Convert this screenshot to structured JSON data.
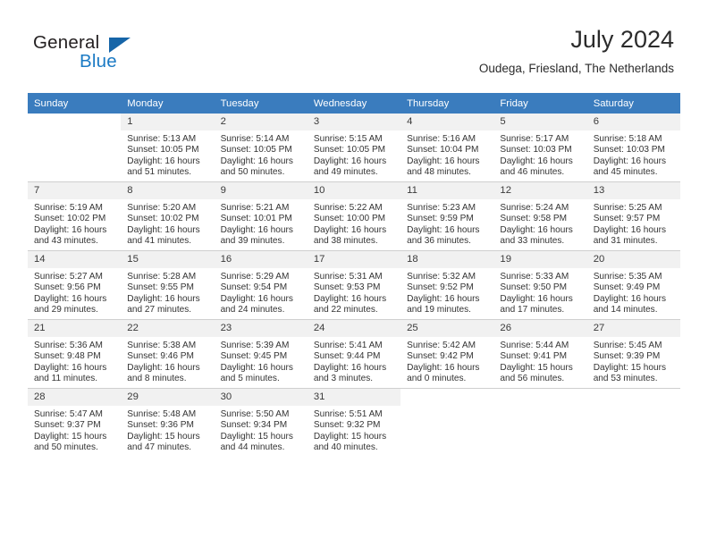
{
  "brand": {
    "word_one": "General",
    "word_two": "Blue",
    "mark": "triangle-logo-mark",
    "accent_dark": "#1665a8",
    "accent_blue": "#1b7ac4"
  },
  "header": {
    "title": "July 2024",
    "subtitle": "Oudega, Friesland, The Netherlands"
  },
  "theme": {
    "header_row_bg": "#3a7cbe",
    "header_row_text": "#ffffff",
    "daynum_bg": "#f1f1f1",
    "grid_line": "#cfcfcf"
  },
  "calendar": {
    "weekday_headers": [
      "Sunday",
      "Monday",
      "Tuesday",
      "Wednesday",
      "Thursday",
      "Friday",
      "Saturday"
    ],
    "weeks": [
      [
        {
          "day": "",
          "blank": true,
          "sunrise": "",
          "sunset": "",
          "daylight_1": "",
          "daylight_2": ""
        },
        {
          "day": "1",
          "sunrise": "Sunrise: 5:13 AM",
          "sunset": "Sunset: 10:05 PM",
          "daylight_1": "Daylight: 16 hours",
          "daylight_2": "and 51 minutes."
        },
        {
          "day": "2",
          "sunrise": "Sunrise: 5:14 AM",
          "sunset": "Sunset: 10:05 PM",
          "daylight_1": "Daylight: 16 hours",
          "daylight_2": "and 50 minutes."
        },
        {
          "day": "3",
          "sunrise": "Sunrise: 5:15 AM",
          "sunset": "Sunset: 10:05 PM",
          "daylight_1": "Daylight: 16 hours",
          "daylight_2": "and 49 minutes."
        },
        {
          "day": "4",
          "sunrise": "Sunrise: 5:16 AM",
          "sunset": "Sunset: 10:04 PM",
          "daylight_1": "Daylight: 16 hours",
          "daylight_2": "and 48 minutes."
        },
        {
          "day": "5",
          "sunrise": "Sunrise: 5:17 AM",
          "sunset": "Sunset: 10:03 PM",
          "daylight_1": "Daylight: 16 hours",
          "daylight_2": "and 46 minutes."
        },
        {
          "day": "6",
          "sunrise": "Sunrise: 5:18 AM",
          "sunset": "Sunset: 10:03 PM",
          "daylight_1": "Daylight: 16 hours",
          "daylight_2": "and 45 minutes."
        }
      ],
      [
        {
          "day": "7",
          "sunrise": "Sunrise: 5:19 AM",
          "sunset": "Sunset: 10:02 PM",
          "daylight_1": "Daylight: 16 hours",
          "daylight_2": "and 43 minutes."
        },
        {
          "day": "8",
          "sunrise": "Sunrise: 5:20 AM",
          "sunset": "Sunset: 10:02 PM",
          "daylight_1": "Daylight: 16 hours",
          "daylight_2": "and 41 minutes."
        },
        {
          "day": "9",
          "sunrise": "Sunrise: 5:21 AM",
          "sunset": "Sunset: 10:01 PM",
          "daylight_1": "Daylight: 16 hours",
          "daylight_2": "and 39 minutes."
        },
        {
          "day": "10",
          "sunrise": "Sunrise: 5:22 AM",
          "sunset": "Sunset: 10:00 PM",
          "daylight_1": "Daylight: 16 hours",
          "daylight_2": "and 38 minutes."
        },
        {
          "day": "11",
          "sunrise": "Sunrise: 5:23 AM",
          "sunset": "Sunset: 9:59 PM",
          "daylight_1": "Daylight: 16 hours",
          "daylight_2": "and 36 minutes."
        },
        {
          "day": "12",
          "sunrise": "Sunrise: 5:24 AM",
          "sunset": "Sunset: 9:58 PM",
          "daylight_1": "Daylight: 16 hours",
          "daylight_2": "and 33 minutes."
        },
        {
          "day": "13",
          "sunrise": "Sunrise: 5:25 AM",
          "sunset": "Sunset: 9:57 PM",
          "daylight_1": "Daylight: 16 hours",
          "daylight_2": "and 31 minutes."
        }
      ],
      [
        {
          "day": "14",
          "sunrise": "Sunrise: 5:27 AM",
          "sunset": "Sunset: 9:56 PM",
          "daylight_1": "Daylight: 16 hours",
          "daylight_2": "and 29 minutes."
        },
        {
          "day": "15",
          "sunrise": "Sunrise: 5:28 AM",
          "sunset": "Sunset: 9:55 PM",
          "daylight_1": "Daylight: 16 hours",
          "daylight_2": "and 27 minutes."
        },
        {
          "day": "16",
          "sunrise": "Sunrise: 5:29 AM",
          "sunset": "Sunset: 9:54 PM",
          "daylight_1": "Daylight: 16 hours",
          "daylight_2": "and 24 minutes."
        },
        {
          "day": "17",
          "sunrise": "Sunrise: 5:31 AM",
          "sunset": "Sunset: 9:53 PM",
          "daylight_1": "Daylight: 16 hours",
          "daylight_2": "and 22 minutes."
        },
        {
          "day": "18",
          "sunrise": "Sunrise: 5:32 AM",
          "sunset": "Sunset: 9:52 PM",
          "daylight_1": "Daylight: 16 hours",
          "daylight_2": "and 19 minutes."
        },
        {
          "day": "19",
          "sunrise": "Sunrise: 5:33 AM",
          "sunset": "Sunset: 9:50 PM",
          "daylight_1": "Daylight: 16 hours",
          "daylight_2": "and 17 minutes."
        },
        {
          "day": "20",
          "sunrise": "Sunrise: 5:35 AM",
          "sunset": "Sunset: 9:49 PM",
          "daylight_1": "Daylight: 16 hours",
          "daylight_2": "and 14 minutes."
        }
      ],
      [
        {
          "day": "21",
          "sunrise": "Sunrise: 5:36 AM",
          "sunset": "Sunset: 9:48 PM",
          "daylight_1": "Daylight: 16 hours",
          "daylight_2": "and 11 minutes."
        },
        {
          "day": "22",
          "sunrise": "Sunrise: 5:38 AM",
          "sunset": "Sunset: 9:46 PM",
          "daylight_1": "Daylight: 16 hours",
          "daylight_2": "and 8 minutes."
        },
        {
          "day": "23",
          "sunrise": "Sunrise: 5:39 AM",
          "sunset": "Sunset: 9:45 PM",
          "daylight_1": "Daylight: 16 hours",
          "daylight_2": "and 5 minutes."
        },
        {
          "day": "24",
          "sunrise": "Sunrise: 5:41 AM",
          "sunset": "Sunset: 9:44 PM",
          "daylight_1": "Daylight: 16 hours",
          "daylight_2": "and 3 minutes."
        },
        {
          "day": "25",
          "sunrise": "Sunrise: 5:42 AM",
          "sunset": "Sunset: 9:42 PM",
          "daylight_1": "Daylight: 16 hours",
          "daylight_2": "and 0 minutes."
        },
        {
          "day": "26",
          "sunrise": "Sunrise: 5:44 AM",
          "sunset": "Sunset: 9:41 PM",
          "daylight_1": "Daylight: 15 hours",
          "daylight_2": "and 56 minutes."
        },
        {
          "day": "27",
          "sunrise": "Sunrise: 5:45 AM",
          "sunset": "Sunset: 9:39 PM",
          "daylight_1": "Daylight: 15 hours",
          "daylight_2": "and 53 minutes."
        }
      ],
      [
        {
          "day": "28",
          "sunrise": "Sunrise: 5:47 AM",
          "sunset": "Sunset: 9:37 PM",
          "daylight_1": "Daylight: 15 hours",
          "daylight_2": "and 50 minutes."
        },
        {
          "day": "29",
          "sunrise": "Sunrise: 5:48 AM",
          "sunset": "Sunset: 9:36 PM",
          "daylight_1": "Daylight: 15 hours",
          "daylight_2": "and 47 minutes."
        },
        {
          "day": "30",
          "sunrise": "Sunrise: 5:50 AM",
          "sunset": "Sunset: 9:34 PM",
          "daylight_1": "Daylight: 15 hours",
          "daylight_2": "and 44 minutes."
        },
        {
          "day": "31",
          "sunrise": "Sunrise: 5:51 AM",
          "sunset": "Sunset: 9:32 PM",
          "daylight_1": "Daylight: 15 hours",
          "daylight_2": "and 40 minutes."
        },
        {
          "day": "",
          "blank": true,
          "sunrise": "",
          "sunset": "",
          "daylight_1": "",
          "daylight_2": ""
        },
        {
          "day": "",
          "blank": true,
          "sunrise": "",
          "sunset": "",
          "daylight_1": "",
          "daylight_2": ""
        },
        {
          "day": "",
          "blank": true,
          "sunrise": "",
          "sunset": "",
          "daylight_1": "",
          "daylight_2": ""
        }
      ]
    ]
  }
}
